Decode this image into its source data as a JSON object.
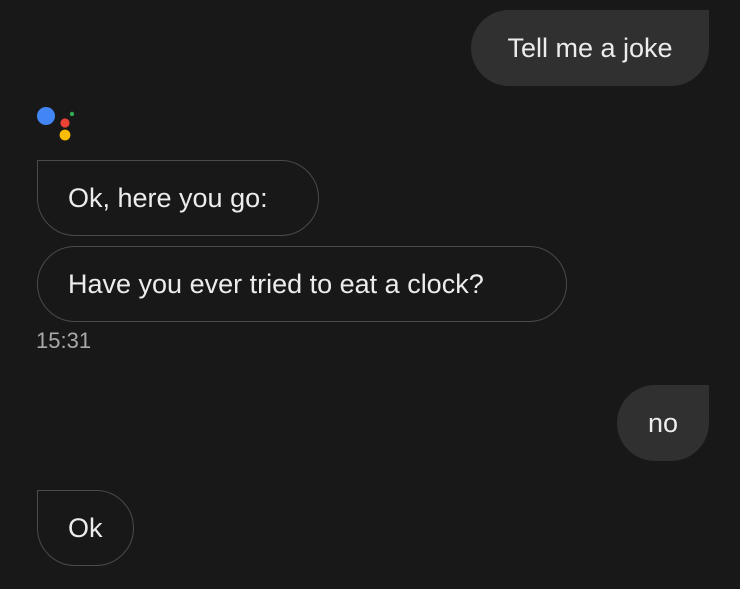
{
  "conversation": {
    "messages": [
      {
        "role": "user",
        "text": "Tell me a joke"
      },
      {
        "role": "assistant",
        "text": "Ok, here you go:"
      },
      {
        "role": "assistant",
        "text": "Have you ever tried to eat a clock?"
      },
      {
        "role": "user",
        "text": "no"
      },
      {
        "role": "assistant",
        "text": "Ok"
      }
    ],
    "timestamp": "15:31"
  },
  "icons": {
    "assistant": "google-assistant-icon"
  },
  "colors": {
    "background": "#181818",
    "user_bubble": "#303030",
    "assistant_border": "#4a4a4a",
    "text": "#ececec",
    "timestamp": "#a9a9a9",
    "dot_blue": "#4285F4",
    "dot_red": "#EA4335",
    "dot_yellow": "#FBBC04",
    "dot_green": "#34A853"
  }
}
